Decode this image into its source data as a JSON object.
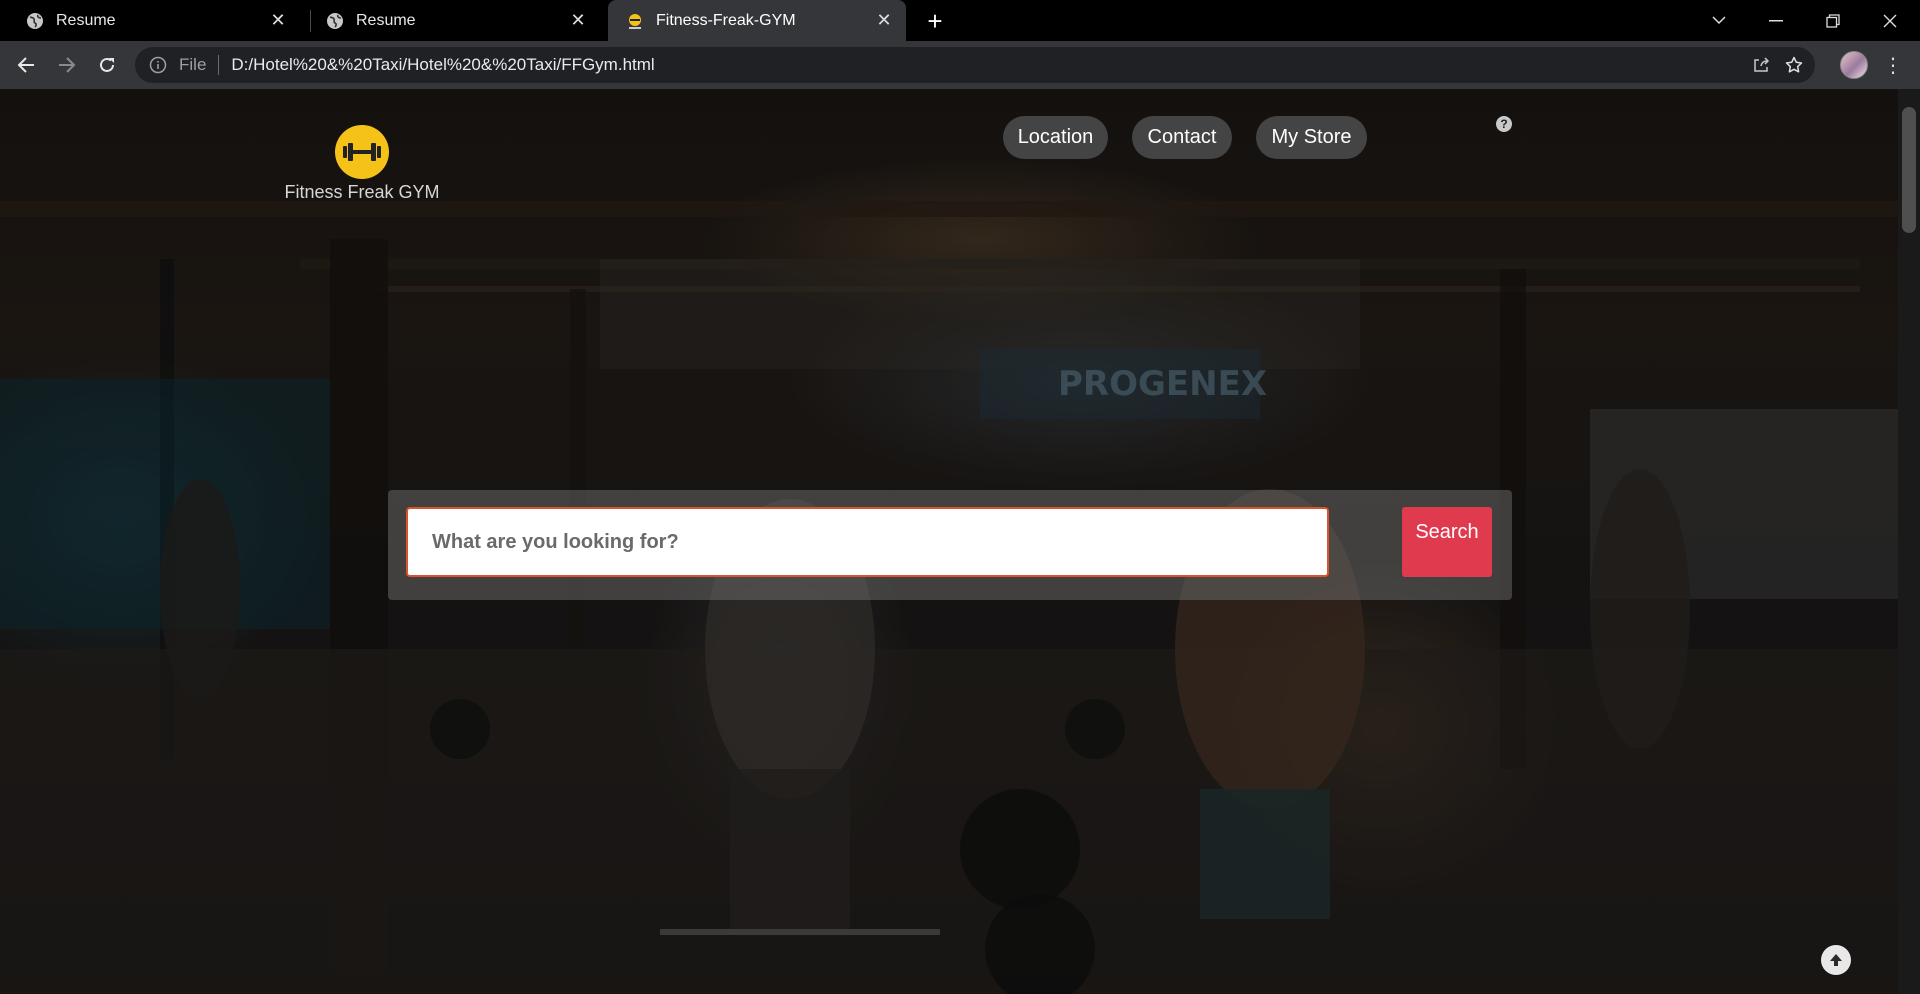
{
  "browser": {
    "tabs": [
      {
        "title": "Resume",
        "icon": "globe-icon"
      },
      {
        "title": "Resume",
        "icon": "globe-icon"
      },
      {
        "title": "Fitness-Freak-GYM",
        "icon": "dumbbell-favicon"
      }
    ],
    "active_tab": 2,
    "address": {
      "scheme_label": "File",
      "url": "D:/Hotel%20&%20Taxi/Hotel%20&%20Taxi/FFGym.html"
    }
  },
  "page": {
    "logo_text": "Fitness Freak GYM",
    "nav": {
      "location": "Location",
      "contact": "Contact",
      "my_store": "My Store"
    },
    "help_glyph": "?",
    "search": {
      "placeholder": "What are you looking for?",
      "button_label": "Search"
    },
    "colors": {
      "logo_yellow": "#f5c318",
      "search_button": "#e03a4e",
      "input_border": "#d9542b"
    }
  }
}
